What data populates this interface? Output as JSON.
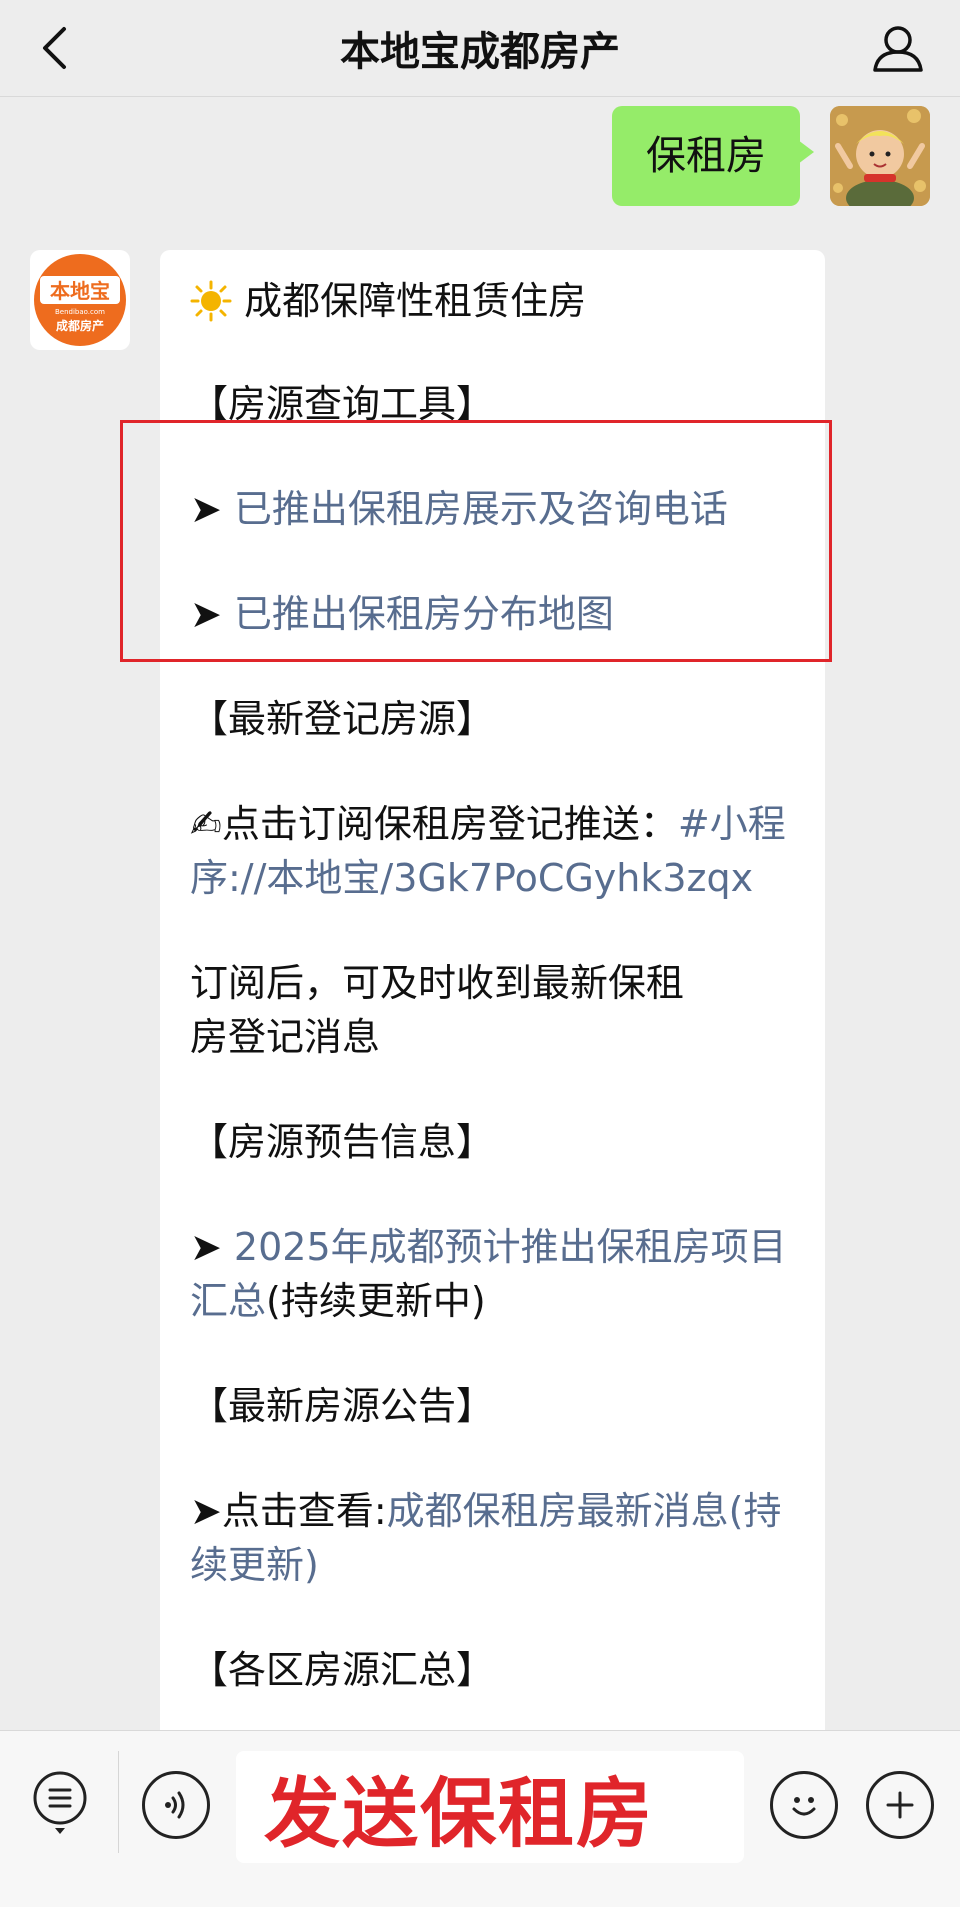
{
  "header": {
    "title": "本地宝成都房产",
    "back_icon": "chevron-left-icon",
    "profile_icon": "user-icon"
  },
  "outgoing": {
    "text": "保租房",
    "bubble_color": "#95ec69"
  },
  "incoming": {
    "avatar": {
      "brand": "本地宝",
      "domain": "Bendibao.com",
      "subtitle": "成都房产",
      "color": "#ee6c1e"
    },
    "title": "成都保障性租赁住房",
    "sections": [
      {
        "heading": "【房源查询工具】",
        "items": [
          {
            "prefix": "➤ ",
            "link": "已推出保租房展示及咨询电话"
          },
          {
            "prefix": "➤ ",
            "link": "已推出保租房分布地图"
          }
        ]
      },
      {
        "heading": "【最新登记房源】",
        "subscribe_prefix": "点击订阅保租房登记推送：",
        "subscribe_link": "#小程序://本地宝/3Gk7PoCGyhk3zqx",
        "note": "订阅后，可及时收到最新保租房登记消息"
      },
      {
        "heading": "【房源预告信息】",
        "items": [
          {
            "prefix": "➤ ",
            "link": "2025年成都预计推出保租房项目汇总",
            "suffix": "(持续更新中)"
          }
        ]
      },
      {
        "heading": "【最新房源公告】",
        "items": [
          {
            "prefix": "➤点击查看:",
            "link": "成都保租房最新消息(持续更新)"
          }
        ]
      },
      {
        "heading": "【各区房源汇总】"
      }
    ],
    "link_color": "#586d8f",
    "highlight_color": "#e0252a"
  },
  "input_bar": {
    "input_text": "发送保租房",
    "input_text_color": "#e0252a",
    "menu_icon": "list-menu-icon",
    "voice_icon": "voice-icon",
    "emoji_icon": "emoji-icon",
    "plus_icon": "plus-icon"
  }
}
